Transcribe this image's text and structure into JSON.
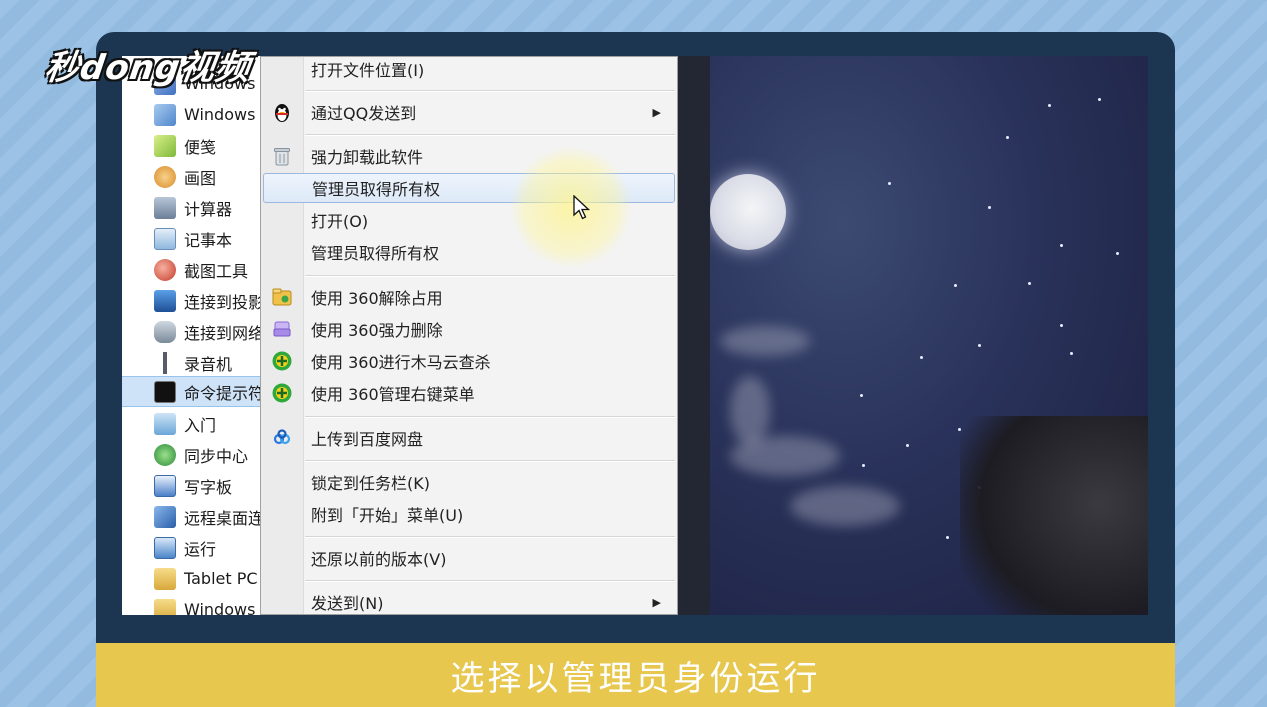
{
  "logo": {
    "text": "秒dong视频"
  },
  "start_list": {
    "items": [
      {
        "label": "Windows",
        "icon": "windows-app-icon",
        "color": "#5b8fd6"
      },
      {
        "label": "Windows",
        "icon": "windows-folder-icon",
        "color": "#6fa0d8"
      },
      {
        "label": "便笺",
        "icon": "sticky-notes-icon",
        "color": "#9fd05a"
      },
      {
        "label": "画图",
        "icon": "paint-icon",
        "color": "#e6a13a"
      },
      {
        "label": "计算器",
        "icon": "calculator-icon",
        "color": "#7d8fa8"
      },
      {
        "label": "记事本",
        "icon": "notepad-icon",
        "color": "#8fb7de"
      },
      {
        "label": "截图工具",
        "icon": "snipping-tool-icon",
        "color": "#d44a3a"
      },
      {
        "label": "连接到投影",
        "icon": "projector-icon",
        "color": "#3a6fb5"
      },
      {
        "label": "连接到网络",
        "icon": "network-projector-icon",
        "color": "#8a9aaa"
      },
      {
        "label": "录音机",
        "icon": "microphone-icon",
        "color": "#555c66"
      },
      {
        "label": "命令提示符",
        "icon": "command-prompt-icon",
        "color": "#1a1a1a"
      },
      {
        "label": "入门",
        "icon": "getting-started-icon",
        "color": "#6aa6d8"
      },
      {
        "label": "同步中心",
        "icon": "sync-center-icon",
        "color": "#3aa64a"
      },
      {
        "label": "写字板",
        "icon": "wordpad-icon",
        "color": "#4a7fc8"
      },
      {
        "label": "远程桌面连接",
        "icon": "remote-desktop-icon",
        "color": "#3a78c8"
      },
      {
        "label": "运行",
        "icon": "run-icon",
        "color": "#4a86c8"
      },
      {
        "label": "Tablet PC",
        "icon": "folder-icon",
        "color": "#e8c25a"
      },
      {
        "label": "Windows",
        "icon": "folder-icon",
        "color": "#e8c25a"
      }
    ],
    "selected_index": 10
  },
  "context_menu": {
    "items": [
      {
        "label": "打开文件位置(I)",
        "icon": "",
        "submenu": false
      },
      {
        "label": "通过QQ发送到",
        "icon": "qq-penguin-icon",
        "submenu": true
      },
      {
        "label": "强力卸载此软件",
        "icon": "trash-icon",
        "submenu": false
      },
      {
        "label": "管理员取得所有权",
        "icon": "",
        "submenu": false,
        "highlighted": true
      },
      {
        "label": "打开(O)",
        "icon": "",
        "submenu": false
      },
      {
        "label": "管理员取得所有权",
        "icon": "",
        "submenu": false
      },
      {
        "label": "使用 360解除占用",
        "icon": "360-unlock-icon",
        "submenu": false
      },
      {
        "label": "使用 360强力删除",
        "icon": "360-shred-icon",
        "submenu": false
      },
      {
        "label": "使用 360进行木马云查杀",
        "icon": "360-antivirus-icon",
        "submenu": false
      },
      {
        "label": "使用 360管理右键菜单",
        "icon": "360-menu-manager-icon",
        "submenu": false
      },
      {
        "label": "上传到百度网盘",
        "icon": "baidu-netdisk-icon",
        "submenu": false
      },
      {
        "label": "锁定到任务栏(K)",
        "icon": "",
        "submenu": false
      },
      {
        "label": "附到「开始」菜单(U)",
        "icon": "",
        "submenu": false
      },
      {
        "label": "还原以前的版本(V)",
        "icon": "",
        "submenu": false
      },
      {
        "label": "发送到(N)",
        "icon": "",
        "submenu": true
      }
    ],
    "submenu_arrow": "▶"
  },
  "caption": {
    "text": "选择以管理员身份运行"
  },
  "colors": {
    "frame": "#1c3551",
    "caption_bg": "#e7c74e",
    "highlight": "#dde9f8",
    "sky": "#29325a"
  }
}
